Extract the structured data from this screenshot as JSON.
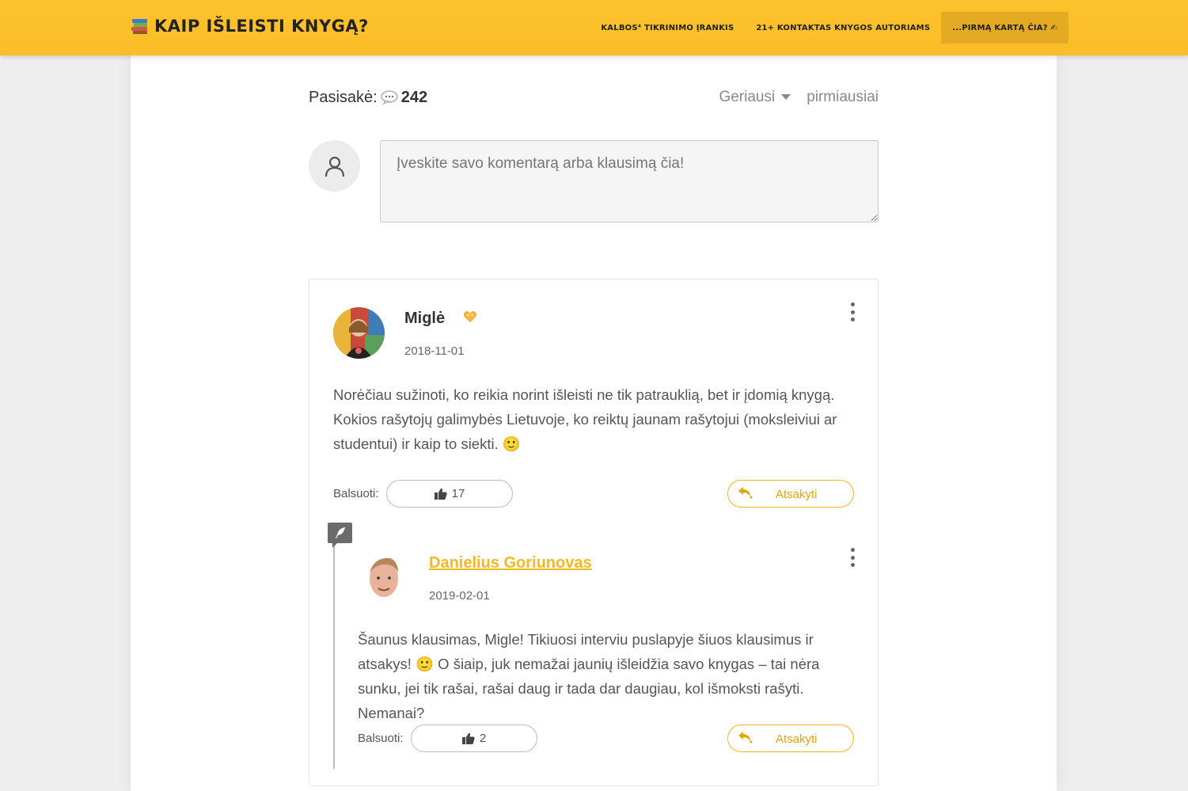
{
  "site": {
    "title": "KAIP IŠLEISTI KNYGĄ?",
    "logo_icon": "books-icon"
  },
  "nav": {
    "items": [
      {
        "label": "KALBOS⁴ TIKRINIMO ĮRANKIS"
      },
      {
        "label": "21+ KONTAKTAS KNYGOS AUTORIAMS"
      },
      {
        "label": "...PIRMĄ KARTĄ ČIA? ✍"
      }
    ]
  },
  "comments": {
    "count_label": "Pasisakė:",
    "count": "242",
    "sort_selected": "Geriausi",
    "sort_alt": "pirmiausiai",
    "input_placeholder": "Įveskite savo komentarą arba klausimą čia!"
  },
  "thread": [
    {
      "author": "Miglė",
      "date": "2018-11-01",
      "text": "Norėčiau sužinoti, ko reikia norint išleisti ne tik patrauklią, bet ir įdomią knygą. Kokios rašytojų galimybės Lietuvoje, ko reiktų jaunam rašytojui (moksleiviui ar studentui) ir kaip to siekti. 🙂",
      "vote_label": "Balsuoti:",
      "votes": "17",
      "reply_label": "Atsakyti"
    },
    {
      "author": "Danielius Goriunovas",
      "date": "2019-02-01",
      "text": "Šaunus klausimas, Migle! Tikiuosi interviu puslapyje šiuos klausimus ir atsakys! 🙂 O šiaip, juk nemažai jaunių išleidžia savo knygas – tai nėra sunku, jei tik rašai, rašai daug ir tada dar daugiau, kol išmoksti rašyti. Nemanai?",
      "vote_label": "Balsuoti:",
      "votes": "2",
      "reply_label": "Atsakyti"
    }
  ],
  "colors": {
    "header": "#fcc32c",
    "accent": "#f3b520",
    "nav_highlight": "#e4aa24"
  }
}
